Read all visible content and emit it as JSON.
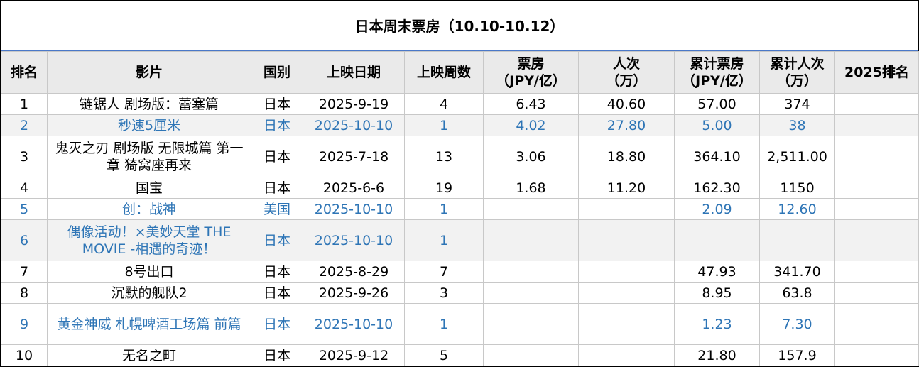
{
  "title": "日本周末票房（10.10-10.12）",
  "headers": {
    "rank": "排名",
    "film": "影片",
    "country": "国别",
    "release_date": "上映日期",
    "weeks": "上映周数",
    "box_office_l1": "票房",
    "box_office_l2": "（JPY/亿）",
    "admissions_l1": "人次",
    "admissions_l2": "（万）",
    "cum_box_office_l1": "累计票房",
    "cum_box_office_l2": "（JPY/亿）",
    "cum_admissions_l1": "累计人次",
    "cum_admissions_l2": "（万）",
    "rank_2025": "2025排名"
  },
  "rows": [
    {
      "rank": "1",
      "film": "链锯人 剧场版：蕾塞篇",
      "country": "日本",
      "release_date": "2025-9-19",
      "weeks": "4",
      "box_office": "6.43",
      "admissions": "40.60",
      "cum_box_office": "57.00",
      "cum_admissions": "374",
      "rank_2025": ""
    },
    {
      "rank": "2",
      "film": "秒速5厘米",
      "country": "日本",
      "release_date": "2025-10-10",
      "weeks": "1",
      "box_office": "4.02",
      "admissions": "27.80",
      "cum_box_office": "5.00",
      "cum_admissions": "38",
      "rank_2025": ""
    },
    {
      "rank": "3",
      "film": "鬼灭之刃 剧场版 无限城篇 第一章 猗窝座再来",
      "country": "日本",
      "release_date": "2025-7-18",
      "weeks": "13",
      "box_office": "3.06",
      "admissions": "18.80",
      "cum_box_office": "364.10",
      "cum_admissions": "2,511.00",
      "rank_2025": ""
    },
    {
      "rank": "4",
      "film": "国宝",
      "country": "日本",
      "release_date": "2025-6-6",
      "weeks": "19",
      "box_office": "1.68",
      "admissions": "11.20",
      "cum_box_office": "162.30",
      "cum_admissions": "1150",
      "rank_2025": ""
    },
    {
      "rank": "5",
      "film": "创：战神",
      "country": "美国",
      "release_date": "2025-10-10",
      "weeks": "1",
      "box_office": "",
      "admissions": "",
      "cum_box_office": "2.09",
      "cum_admissions": "12.60",
      "rank_2025": ""
    },
    {
      "rank": "6",
      "film": "偶像活动！×美妙天堂 THE MOVIE -相遇的奇迹！",
      "country": "日本",
      "release_date": "2025-10-10",
      "weeks": "1",
      "box_office": "",
      "admissions": "",
      "cum_box_office": "",
      "cum_admissions": "",
      "rank_2025": ""
    },
    {
      "rank": "7",
      "film": "8号出口",
      "country": "日本",
      "release_date": "2025-8-29",
      "weeks": "7",
      "box_office": "",
      "admissions": "",
      "cum_box_office": "47.93",
      "cum_admissions": "341.70",
      "rank_2025": ""
    },
    {
      "rank": "8",
      "film": "沉默的舰队2",
      "country": "日本",
      "release_date": "2025-9-26",
      "weeks": "3",
      "box_office": "",
      "admissions": "",
      "cum_box_office": "8.95",
      "cum_admissions": "63.8",
      "rank_2025": ""
    },
    {
      "rank": "9",
      "film": "黄金神威 札幌啤酒工场篇 前篇",
      "country": "日本",
      "release_date": "2025-10-10",
      "weeks": "1",
      "box_office": "",
      "admissions": "",
      "cum_box_office": "1.23",
      "cum_admissions": "7.30",
      "rank_2025": ""
    },
    {
      "rank": "10",
      "film": "无名之町",
      "country": "日本",
      "release_date": "2025-9-12",
      "weeks": "5",
      "box_office": "",
      "admissions": "",
      "cum_box_office": "21.80",
      "cum_admissions": "157.9",
      "rank_2025": ""
    }
  ],
  "colors": {
    "new_release_text": "#2e75b6",
    "header_bg": "#eaeaea",
    "title_rule": "#4a78c8",
    "alt_row_bg": "#f2f2f2"
  }
}
